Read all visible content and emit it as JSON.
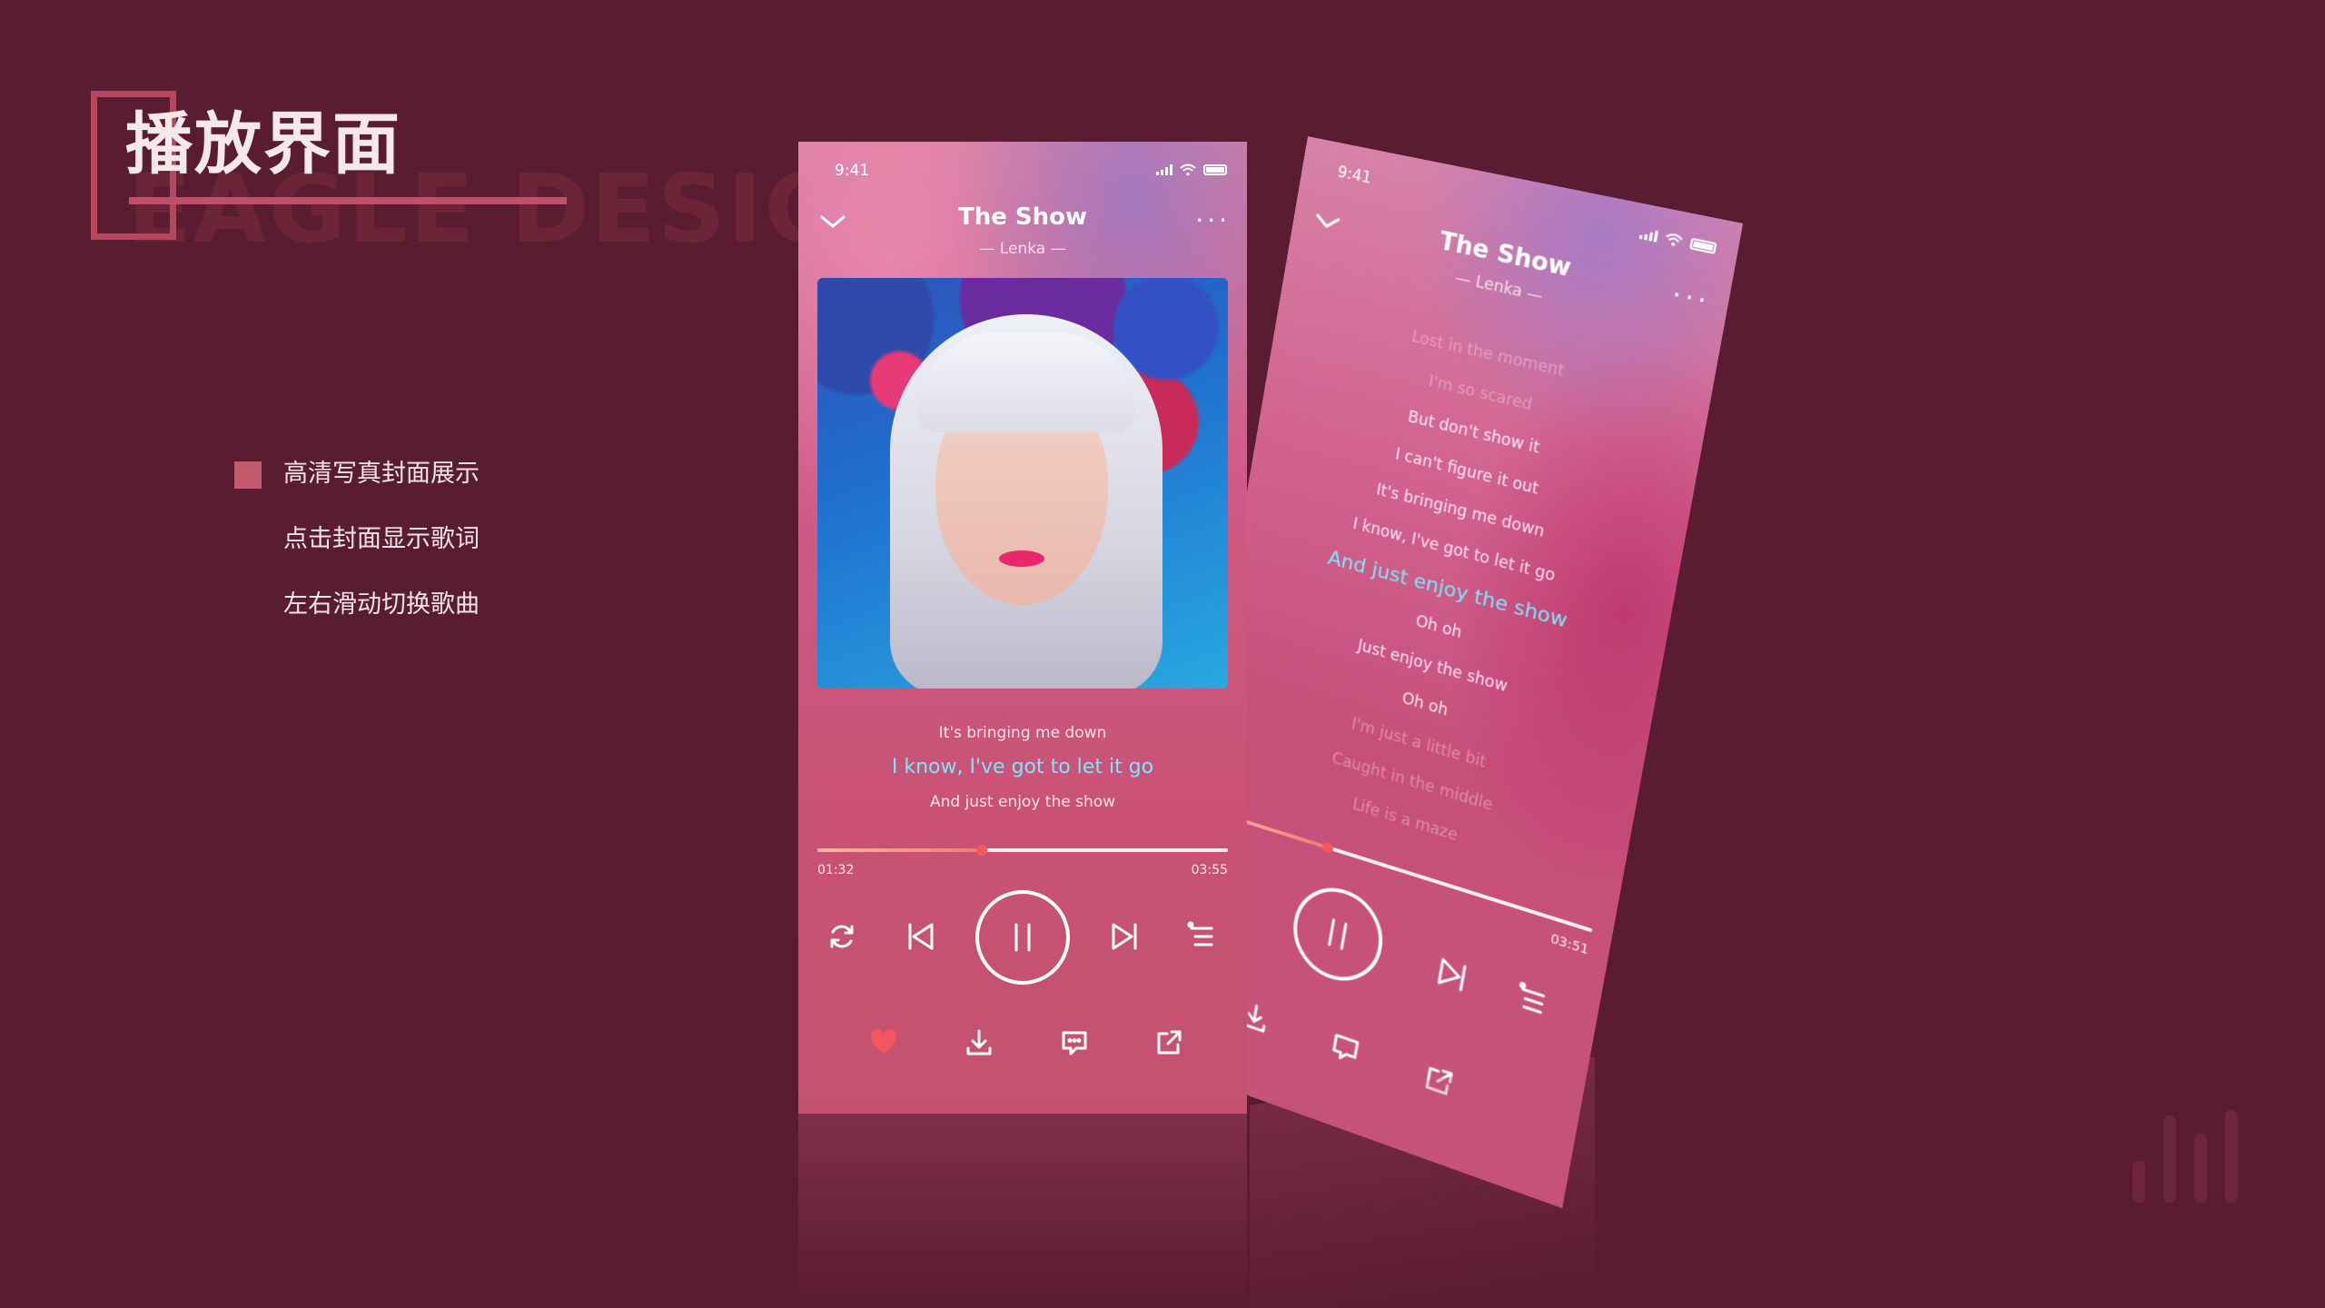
{
  "slide": {
    "title": "播放界面",
    "watermark": "EAGLE DESIGN",
    "features": [
      "高清写真封面展示",
      "点击封面显示歌词",
      "左右滑动切换歌曲"
    ]
  },
  "front_phone": {
    "status_time": "9:41",
    "song_title": "The Show",
    "artist": "— Lenka —",
    "lyrics": [
      {
        "text": "It's bringing me down",
        "active": false
      },
      {
        "text": "I know, I've got to let it go",
        "active": true
      },
      {
        "text": "And just enjoy the show",
        "active": false
      }
    ],
    "current_time": "01:32",
    "duration": "03:55",
    "progress_fraction": 0.4,
    "icons": {
      "collapse": "chevron-down-icon",
      "more": "more-dots-icon",
      "loop": "loop-icon",
      "prev": "previous-icon",
      "pause": "pause-icon",
      "next": "next-icon",
      "playlist": "playlist-icon",
      "like": "heart-icon",
      "download": "download-icon",
      "comment": "comment-icon",
      "share": "share-icon"
    },
    "colors": {
      "accent_lyric": "#7ce6ff",
      "like": "#f5555c"
    }
  },
  "back_phone": {
    "status_time": "9:41",
    "song_title": "The Show",
    "artist": "— Lenka —",
    "lyrics": [
      {
        "text": "Lost in the moment",
        "state": "fade"
      },
      {
        "text": "I'm so scared",
        "state": "fade"
      },
      {
        "text": "But don't show it",
        "state": "normal"
      },
      {
        "text": "I can't figure it out",
        "state": "normal"
      },
      {
        "text": "It's bringing me down",
        "state": "normal"
      },
      {
        "text": "I know, I've got to let it go",
        "state": "normal"
      },
      {
        "text": "And just enjoy the show",
        "state": "active"
      },
      {
        "text": "Oh oh",
        "state": "normal"
      },
      {
        "text": "Just enjoy the show",
        "state": "normal"
      },
      {
        "text": "Oh oh",
        "state": "normal"
      },
      {
        "text": "I'm just a little bit",
        "state": "fade"
      },
      {
        "text": "Caught in the middle",
        "state": "fade"
      },
      {
        "text": "Life is a maze",
        "state": "fade"
      }
    ],
    "duration": "03:51",
    "progress_fraction": 0.32
  }
}
